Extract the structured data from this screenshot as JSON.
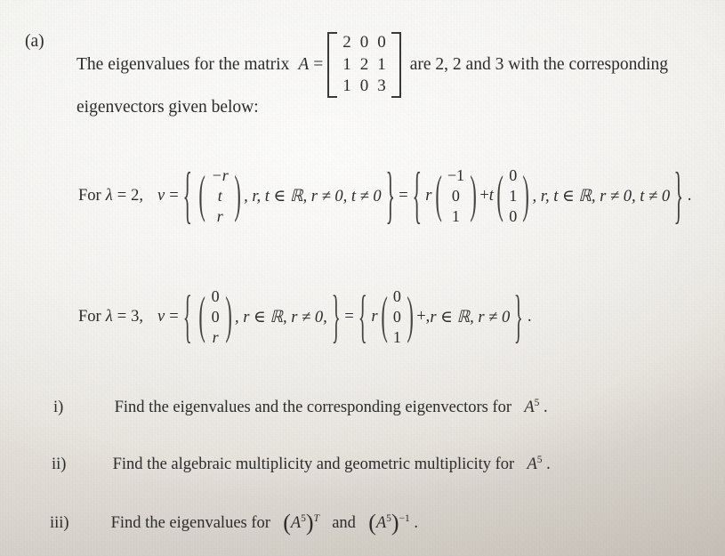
{
  "document": {
    "kind": "scanned-worksheet-page",
    "background_color": "#eceae5",
    "ink_color": "#2b2b2b"
  },
  "part": {
    "label": "(a)",
    "intro_before_matrix": "The eigenvalues for the matrix",
    "matrix_var": "A",
    "equals": "=",
    "intro_after_matrix": "are  2, 2 and 3  with the corresponding",
    "second_line": "eigenvectors given below:"
  },
  "matrix": {
    "name": "A",
    "rows": [
      [
        "2",
        "0",
        "0"
      ],
      [
        "1",
        "2",
        "1"
      ],
      [
        "1",
        "0",
        "3"
      ]
    ],
    "bracket": "square"
  },
  "eigen_rows": [
    {
      "id": "lambda-2",
      "lead": "For",
      "lambda_symbol": "λ",
      "lambda_equals": "=",
      "lambda_value": "2",
      "comma": ",",
      "v_symbol": "v",
      "v_equals": "=",
      "left_vector": [
        "−r",
        "t",
        "r"
      ],
      "left_conditions": ", r, t ∈ ℝ, r ≠ 0, t ≠ 0",
      "middle_equals": "=",
      "scalar_1": "r",
      "vector_1": [
        "−1",
        "0",
        "1"
      ],
      "plus": "+",
      "scalar_2": "t",
      "vector_2": [
        "0",
        "1",
        "0"
      ],
      "right_conditions": ", r, t ∈ ℝ, r ≠ 0, t ≠ 0",
      "trailing": "."
    },
    {
      "id": "lambda-3",
      "lead": "For",
      "lambda_symbol": "λ",
      "lambda_equals": "=",
      "lambda_value": "3",
      "comma": ",",
      "v_symbol": "v",
      "v_equals": "=",
      "left_vector": [
        "0",
        "0",
        "r"
      ],
      "left_conditions": ", r ∈ ℝ, r ≠ 0,",
      "middle_equals": "=",
      "scalar_1": "r",
      "vector_1": [
        "0",
        "0",
        "1"
      ],
      "plus": "+,",
      "right_conditions": " r ∈ ℝ, r ≠ 0",
      "trailing": "."
    }
  ],
  "questions": [
    {
      "num": "i)",
      "text_before": "Find the eigenvalues and the corresponding eigenvectors for",
      "expr_base": "A",
      "expr_sup": "5",
      "text_after": "."
    },
    {
      "num": "ii)",
      "text_before": "Find the algebraic multiplicity and geometric multiplicity for",
      "expr_base": "A",
      "expr_sup": "5",
      "text_after": "."
    },
    {
      "num": "iii)",
      "text_before": "Find the eigenvalues for",
      "expr1_open": "(",
      "expr1_base": "A",
      "expr1_sup": "5",
      "expr1_close": ")",
      "expr1_outer_sup": "T",
      "conjunction": "and",
      "expr2_open": "(",
      "expr2_base": "A",
      "expr2_sup": "5",
      "expr2_close": ")",
      "expr2_outer_sup": "−1",
      "text_after": "."
    }
  ],
  "symbols": {
    "brace_open": "{",
    "brace_close": "}",
    "paren_open": "(",
    "paren_close": ")"
  }
}
